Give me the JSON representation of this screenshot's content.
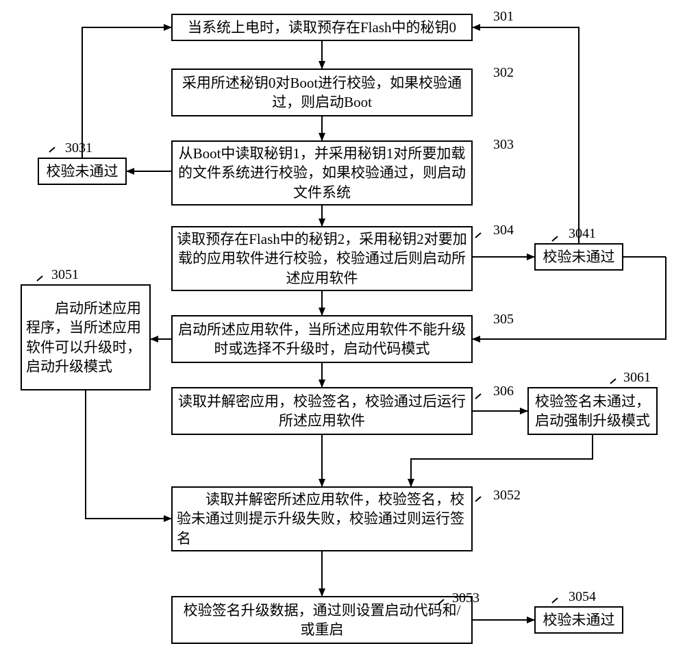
{
  "nodes": {
    "n301": {
      "num": "301",
      "text": "当系统上电时，读取预存在Flash中的秘钥0"
    },
    "n302": {
      "num": "302",
      "text": "采用所述秘钥0对Boot进行校验，如果校验通过，则启动Boot"
    },
    "n303": {
      "num": "303",
      "text": "从Boot中读取秘钥1，并采用秘钥1对所要加载的文件系统进行校验，如果校验通过，则启动文件系统"
    },
    "n3031": {
      "num": "3031",
      "text": "校验未通过"
    },
    "n304": {
      "num": "304",
      "text": "读取预存在Flash中的秘钥2，采用秘钥2对要加载的应用软件进行校验，校验通过后则启动所述应用软件"
    },
    "n3041": {
      "num": "3041",
      "text": "校验未通过"
    },
    "n305": {
      "num": "305",
      "text": "启动所述应用软件，当所述应用软件不能升级时或选择不升级时，启动代码模式"
    },
    "n3051": {
      "num": "3051",
      "text": "　　启动所述应用程序，当所述应用软件可以升级时，启动升级模式"
    },
    "n306": {
      "num": "306",
      "text": "读取并解密应用，校验签名，校验通过后运行所述应用软件"
    },
    "n3061": {
      "num": "3061",
      "text": "校验签名未通过，启动强制升级模式"
    },
    "n3052": {
      "num": "3052",
      "text": "　　读取并解密所述应用软件，校验签名，校验未通过则提示升级失败，校验通过则运行签名"
    },
    "n3053": {
      "num": "3053",
      "text": "校验签名升级数据，通过则设置启动代码和/或重启"
    },
    "n3054": {
      "num": "3054",
      "text": "校验未通过"
    }
  }
}
